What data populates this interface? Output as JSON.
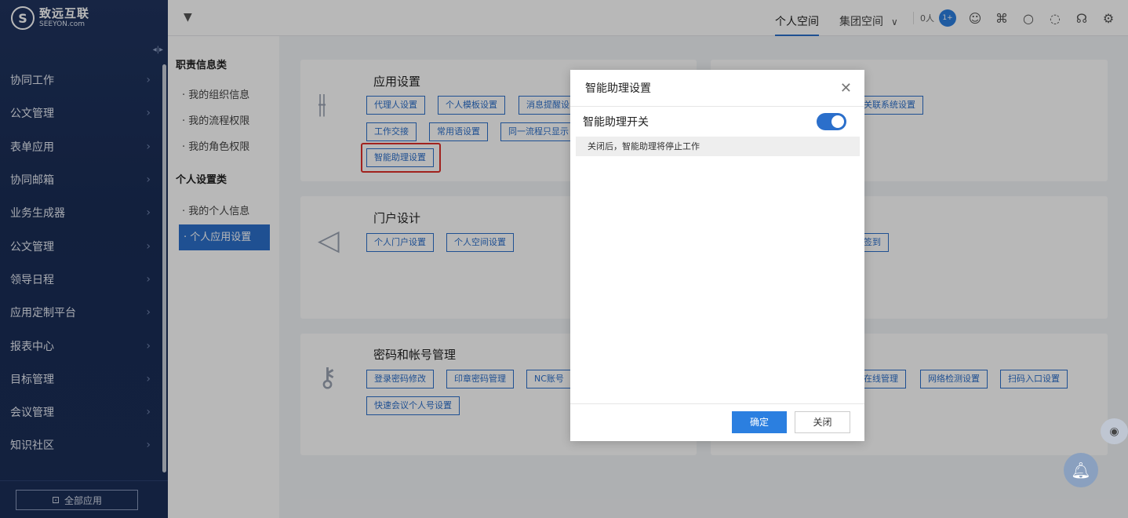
{
  "logo": {
    "cn": "致远互联",
    "en": "SEEYON.com",
    "mark": "S"
  },
  "sidebar": {
    "items": [
      {
        "label": "协同工作"
      },
      {
        "label": "公文管理"
      },
      {
        "label": "表单应用"
      },
      {
        "label": "协同邮箱"
      },
      {
        "label": "业务生成器"
      },
      {
        "label": "公文管理"
      },
      {
        "label": "领导日程"
      },
      {
        "label": "应用定制平台"
      },
      {
        "label": "报表中心"
      },
      {
        "label": "目标管理"
      },
      {
        "label": "会议管理"
      },
      {
        "label": "知识社区"
      }
    ],
    "all_apps": "全部应用"
  },
  "topbar": {
    "tabs": [
      {
        "label": "个人空间",
        "active": true
      },
      {
        "label": "集团空间",
        "active": false
      }
    ],
    "online_count": "0人",
    "badge": "1+"
  },
  "subnav": {
    "group1_title": "职责信息类",
    "group1_items": [
      "我的组织信息",
      "我的流程权限",
      "我的角色权限"
    ],
    "group2_title": "个人设置类",
    "group2_items": [
      "我的个人信息",
      "个人应用设置"
    ]
  },
  "cards": {
    "app_settings": {
      "title": "应用设置",
      "buttons": [
        "代理人设置",
        "个人模板设置",
        "消息提醒设",
        "工作交接",
        "常用语设置",
        "同一流程只显示",
        "智能助理设置"
      ]
    },
    "related_systems": {
      "buttons": [
        "关联系统设置"
      ]
    },
    "portal": {
      "title": "门户设计",
      "buttons": [
        "个人门户设置",
        "个人空间设置"
      ]
    },
    "signin": {
      "buttons": [
        "签到"
      ]
    },
    "password": {
      "title": "密码和帐号管理",
      "buttons": [
        "登录密码修改",
        "印章密码管理",
        "NC账号",
        "快速会议个人号设置"
      ]
    },
    "network": {
      "buttons": [
        "在线管理",
        "网络检测设置",
        "扫码入口设置"
      ]
    }
  },
  "dialog": {
    "title": "智能助理设置",
    "switch_label": "智能助理开关",
    "switch_on": true,
    "note": "关闭后，智能助理将停止工作",
    "ok": "确定",
    "close": "关闭"
  },
  "colors": {
    "brand": "#2b6fcb",
    "sidebar_bg": "#1b2e58",
    "highlight": "#e0302a"
  }
}
